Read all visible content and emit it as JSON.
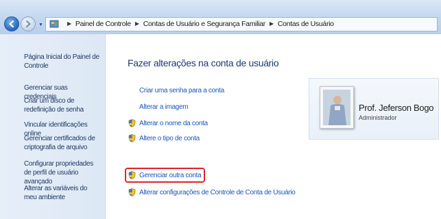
{
  "addressbar": {
    "breadcrumb": [
      "Painel de Controle",
      "Contas de Usuário e Segurança Familiar",
      "Contas de Usuário"
    ],
    "icons": {
      "back": "back-arrow-icon",
      "forward": "forward-arrow-icon",
      "location": "control-panel-icon"
    }
  },
  "sidebar": {
    "items": [
      {
        "label": "Página Inicial do Painel de Controle"
      },
      {
        "label": "Gerenciar suas credenciais"
      },
      {
        "label": "Criar um disco de redefinição de senha"
      },
      {
        "label": "Vincular identificações online"
      },
      {
        "label": "Gerenciar certificados de criptografia de arquivo"
      },
      {
        "label": "Configurar propriedades de perfil de usuário avançado"
      },
      {
        "label": "Alterar as variáveis do meu ambiente"
      }
    ]
  },
  "main": {
    "title": "Fazer alterações na conta de usuário",
    "tasks": [
      {
        "label": "Criar uma senha para a conta",
        "shield": false
      },
      {
        "label": "Alterar a imagem",
        "shield": false
      },
      {
        "label": "Alterar o nome da conta",
        "shield": true
      },
      {
        "label": "Altere o tipo de conta",
        "shield": true
      }
    ],
    "other_tasks": [
      {
        "label": "Gerenciar outra conta",
        "shield": true,
        "highlighted": true
      },
      {
        "label": "Alterar configurações de Controle de Conta de Usuário",
        "shield": true
      }
    ]
  },
  "account": {
    "name": "Prof. Jeferson Bogo",
    "role": "Administrador"
  },
  "colors": {
    "link": "#1a56b8",
    "title": "#1e3a6e",
    "sidebar_link": "#1f3a63",
    "highlight": "#e0222a"
  }
}
